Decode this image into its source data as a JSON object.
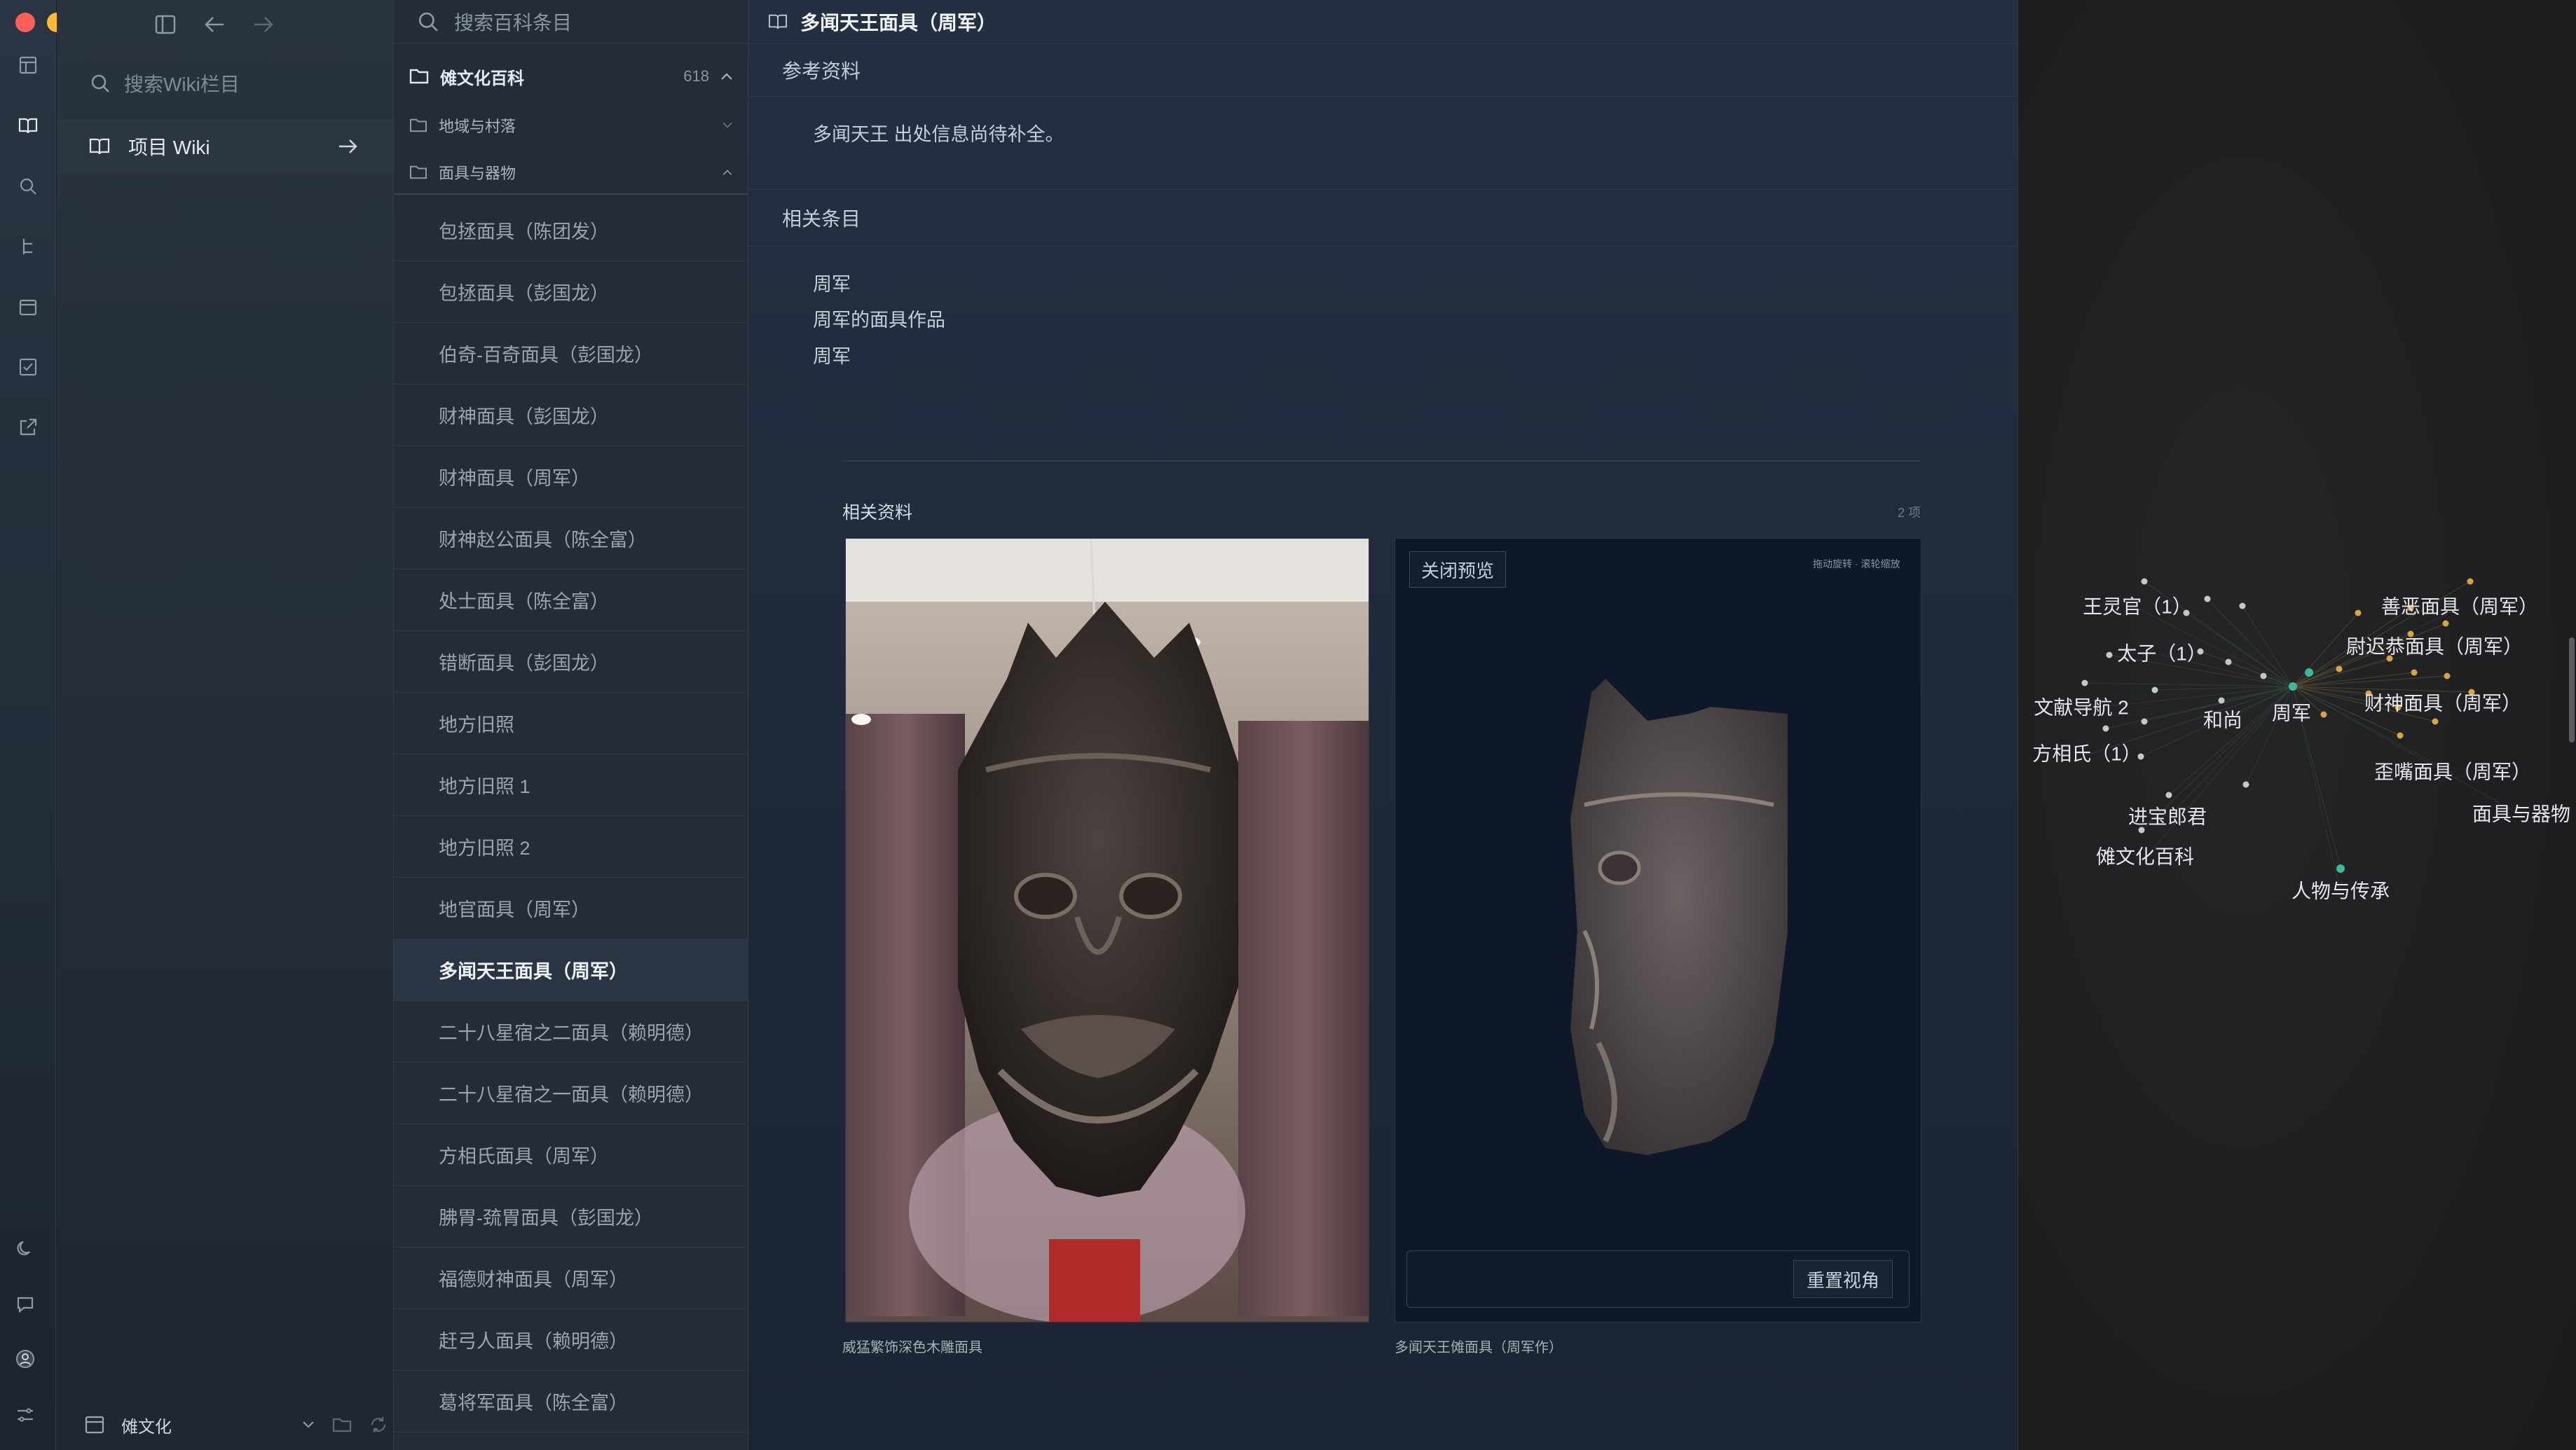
{
  "window": {
    "traffic_lights": [
      "#ff5f57",
      "#febc2e",
      "#28c840"
    ]
  },
  "rail": {
    "icons": [
      "layout-icon",
      "book-icon",
      "search-icon",
      "tree-icon",
      "calendar-icon",
      "checklist-icon",
      "export-icon"
    ],
    "bottom_icons": [
      "moon-icon",
      "chat-icon",
      "user-icon",
      "settings-icon"
    ]
  },
  "wiki_sidebar": {
    "search_placeholder": "搜索Wiki栏目",
    "item_label": "项目 Wiki",
    "bottom_label": "傩文化"
  },
  "entries": {
    "search_placeholder": "搜索百科条目",
    "root_folder": {
      "label": "傩文化百科",
      "count": "618"
    },
    "subfolders": [
      "地域与村落",
      "面具与器物"
    ],
    "items": [
      "包拯面具（陈团发）",
      "包拯面具（彭国龙）",
      "伯奇-百奇面具（彭国龙）",
      "财神面具（彭国龙）",
      "财神面具（周军）",
      "财神赵公面具（陈全富）",
      "处士面具（陈全富）",
      "错断面具（彭国龙）",
      "地方旧照",
      "地方旧照 1",
      "地方旧照 2",
      "地官面具（周军）",
      "多闻天王面具（周军）",
      "二十八星宿之二面具（赖明德）",
      "二十八星宿之一面具（赖明德）",
      "方相氏面具（周军）",
      "胇胃-巯胃面具（彭国龙）",
      "福德财神面具（周军）",
      "赶弓人面具（赖明德）",
      "葛将军面具（陈全富）"
    ],
    "active_index": 12
  },
  "doc": {
    "title": "多闻天王面具（周军）",
    "references_heading": "参考资料",
    "references_text": "多闻天王 出处信息尚待补全。",
    "related_heading": "相关条目",
    "related_items": [
      "周军",
      "周军的面具作品",
      "周军"
    ],
    "materials_heading": "相关资料",
    "materials_count": "2 项",
    "caption_1": "威猛繁饰深色木雕面具",
    "caption_2": "多闻天王傩面具（周军作）",
    "close_preview": "关闭预览",
    "hint": "拖动旋转 · 滚轮缩放",
    "reset_view": "重置视角"
  },
  "graph": {
    "labels": [
      "王灵官（1）",
      "善恶面具（周军）",
      "太子（1）",
      "尉迟恭面具（周军）",
      "文献导航 2",
      "和尚",
      "周军",
      "财神面具（周军）",
      "方相氏（1）",
      "歪嘴面具（周军）",
      "进宝郎君",
      "面具与器物",
      "傩文化百科",
      "人物与传承"
    ]
  }
}
